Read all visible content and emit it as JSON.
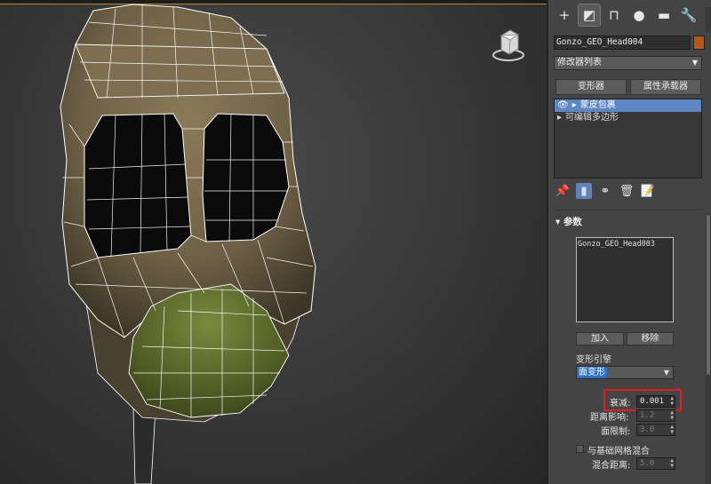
{
  "viewport": {
    "name": "3D perspective viewport",
    "highlight_color": "#e02020",
    "wire_color": "#ffffff",
    "mesh_colors": {
      "mask": "#6e6046",
      "mouth": "#5b6a2c"
    }
  },
  "panel": {
    "tabs": [
      {
        "icon": "create-icon",
        "glyph": "+"
      },
      {
        "icon": "modify-icon",
        "glyph": "◩"
      },
      {
        "icon": "hierarchy-icon",
        "glyph": "⊓"
      },
      {
        "icon": "motion-icon",
        "glyph": "●"
      },
      {
        "icon": "display-icon",
        "glyph": "▬"
      },
      {
        "icon": "utilities-icon",
        "glyph": "🔧"
      }
    ],
    "object_name": "Gonzo_GEO_Head004",
    "object_color": "#b5571b",
    "modifier_list": "修改器列表",
    "buttons": {
      "morpher": "变形器",
      "attribute_holder": "属性承载器"
    },
    "stack": [
      {
        "label": "蒙皮包裹",
        "selected": true
      },
      {
        "label": "可编辑多边形",
        "selected": false
      }
    ],
    "rollout": {
      "title": "参数",
      "target_list": [
        "Gonzo_GEO_Head003"
      ],
      "add_label": "加入",
      "remove_label": "移除",
      "deform_engine_label": "变形引擎",
      "deform_engine_value": "面变形",
      "falloff_label": "衰减:",
      "falloff_value": "0.001",
      "distance_infl_label": "距离影响:",
      "distance_infl_value": "1.2",
      "face_limit_label": "面限制:",
      "face_limit_value": "3.0",
      "blend_label": "与基础网格混合",
      "blend_dist_label": "混合距离:",
      "blend_dist_value": "5.0"
    }
  }
}
